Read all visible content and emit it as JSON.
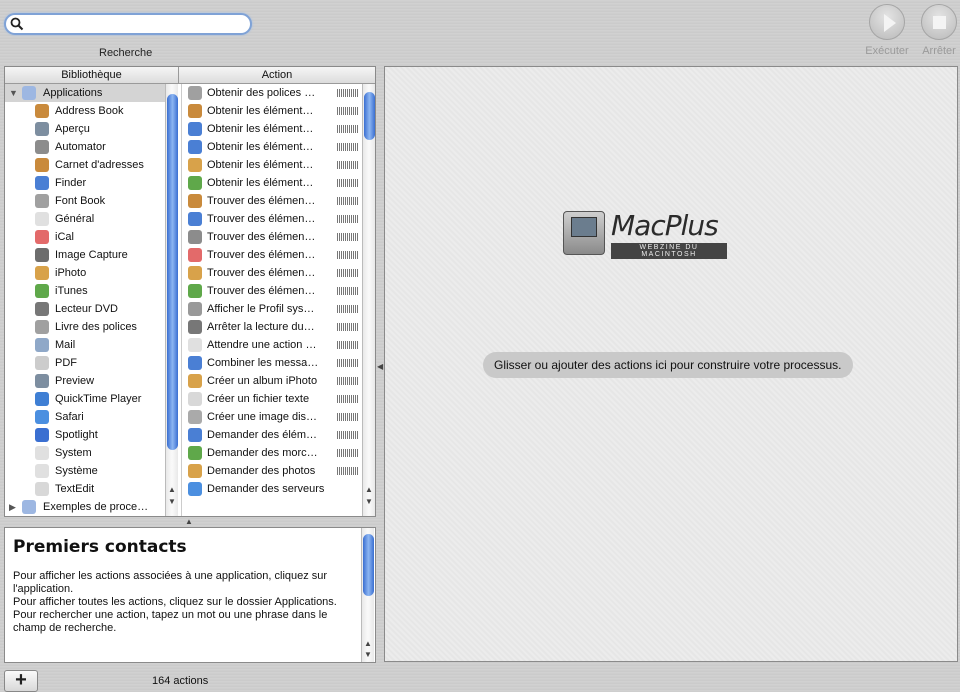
{
  "toolbar": {
    "search_value": "",
    "search_label": "Recherche",
    "run_label": "Exécuter",
    "stop_label": "Arrêter"
  },
  "library": {
    "header": "Bibliothèque",
    "items": [
      {
        "label": "Applications",
        "icon": "applications-folder-icon",
        "color": "#9db7e2",
        "top": true,
        "selected": true,
        "tri": "▼"
      },
      {
        "label": "Address Book",
        "icon": "address-book-icon",
        "color": "#c98a3c"
      },
      {
        "label": "Aperçu",
        "icon": "preview-icon",
        "color": "#7d8ea0"
      },
      {
        "label": "Automator",
        "icon": "automator-icon",
        "color": "#8c8c8c"
      },
      {
        "label": "Carnet d'adresses",
        "icon": "address-book-icon",
        "color": "#c98a3c"
      },
      {
        "label": "Finder",
        "icon": "finder-icon",
        "color": "#4a7fd4"
      },
      {
        "label": "Font Book",
        "icon": "font-book-icon",
        "color": "#a0a0a0"
      },
      {
        "label": "Général",
        "icon": "general-x-icon",
        "color": "#e0e0e0"
      },
      {
        "label": "iCal",
        "icon": "ical-icon",
        "color": "#e36a6a"
      },
      {
        "label": "Image Capture",
        "icon": "camera-icon",
        "color": "#6d6d6d"
      },
      {
        "label": "iPhoto",
        "icon": "iphoto-icon",
        "color": "#d8a24a"
      },
      {
        "label": "iTunes",
        "icon": "itunes-icon",
        "color": "#5fa84a"
      },
      {
        "label": "Lecteur DVD",
        "icon": "dvd-icon",
        "color": "#777777"
      },
      {
        "label": "Livre des polices",
        "icon": "font-book-icon",
        "color": "#a0a0a0"
      },
      {
        "label": "Mail",
        "icon": "mail-icon",
        "color": "#8fa8c8"
      },
      {
        "label": "PDF",
        "icon": "pdf-icon",
        "color": "#cccccc"
      },
      {
        "label": "Preview",
        "icon": "preview-icon",
        "color": "#7d8ea0"
      },
      {
        "label": "QuickTime Player",
        "icon": "quicktime-icon",
        "color": "#3f7fd4"
      },
      {
        "label": "Safari",
        "icon": "safari-icon",
        "color": "#4b8fe0"
      },
      {
        "label": "Spotlight",
        "icon": "spotlight-icon",
        "color": "#3a6fd1"
      },
      {
        "label": "System",
        "icon": "system-x-icon",
        "color": "#e0e0e0"
      },
      {
        "label": "Système",
        "icon": "system-x-icon",
        "color": "#e0e0e0"
      },
      {
        "label": "TextEdit",
        "icon": "textedit-icon",
        "color": "#d8d8d8"
      },
      {
        "label": "Exemples de proce…",
        "icon": "folder-icon",
        "color": "#9db7e2",
        "top": true,
        "tri": "▶"
      }
    ]
  },
  "actions": {
    "header": "Action",
    "items": [
      {
        "label": "Obtenir des polices …",
        "icon": "font-book-icon",
        "color": "#a0a0a0",
        "rate": true
      },
      {
        "label": "Obtenir les élément…",
        "icon": "address-book-icon",
        "color": "#c98a3c",
        "rate": true
      },
      {
        "label": "Obtenir les élément…",
        "icon": "finder-icon",
        "color": "#4a7fd4",
        "rate": true
      },
      {
        "label": "Obtenir les élément…",
        "icon": "finder-icon",
        "color": "#4a7fd4",
        "rate": true
      },
      {
        "label": "Obtenir les élément…",
        "icon": "iphoto-icon",
        "color": "#d8a24a",
        "rate": true
      },
      {
        "label": "Obtenir les élément…",
        "icon": "itunes-icon",
        "color": "#5fa84a",
        "rate": true
      },
      {
        "label": "Trouver des élémen…",
        "icon": "address-book-icon",
        "color": "#c98a3c",
        "rate": true
      },
      {
        "label": "Trouver des élémen…",
        "icon": "finder-icon",
        "color": "#4a7fd4",
        "rate": true
      },
      {
        "label": "Trouver des élémen…",
        "icon": "automator-icon",
        "color": "#8c8c8c",
        "rate": true
      },
      {
        "label": "Trouver des élémen…",
        "icon": "ical-icon",
        "color": "#e36a6a",
        "rate": true
      },
      {
        "label": "Trouver des élémen…",
        "icon": "iphoto-icon",
        "color": "#d8a24a",
        "rate": true
      },
      {
        "label": "Trouver des élémen…",
        "icon": "itunes-icon",
        "color": "#5fa84a",
        "rate": true
      },
      {
        "label": "Afficher le Profil sys…",
        "icon": "system-profiler-icon",
        "color": "#999999",
        "rate": true
      },
      {
        "label": "Arrêter la lecture du…",
        "icon": "dvd-icon",
        "color": "#777777",
        "rate": true
      },
      {
        "label": "Attendre une action …",
        "icon": "general-x-icon",
        "color": "#e0e0e0",
        "rate": true
      },
      {
        "label": "Combiner les messa…",
        "icon": "finder-icon",
        "color": "#4a7fd4",
        "rate": true
      },
      {
        "label": "Créer un album iPhoto",
        "icon": "iphoto-icon",
        "color": "#d8a24a",
        "rate": true
      },
      {
        "label": "Créer un fichier texte",
        "icon": "textedit-icon",
        "color": "#d8d8d8",
        "rate": true
      },
      {
        "label": "Créer une image dis…",
        "icon": "disk-image-icon",
        "color": "#aaaaaa",
        "rate": true
      },
      {
        "label": "Demander des élém…",
        "icon": "finder-icon",
        "color": "#4a7fd4",
        "rate": true
      },
      {
        "label": "Demander des morc…",
        "icon": "itunes-icon",
        "color": "#5fa84a",
        "rate": true
      },
      {
        "label": "Demander des photos",
        "icon": "iphoto-icon",
        "color": "#d8a24a",
        "rate": true
      },
      {
        "label": "Demander des serveurs",
        "icon": "network-icon",
        "color": "#4b8fe0",
        "rate": false
      }
    ]
  },
  "description": {
    "title": "Premiers contacts",
    "lines": [
      "Pour afficher les actions associées à une application, cliquez sur l'application.",
      "Pour afficher toutes les actions, cliquez sur le dossier Applications.",
      "Pour rechercher une action, tapez un mot ou une phrase dans le champ de recherche."
    ]
  },
  "footer": {
    "add_label": "+",
    "count_label": "164 actions"
  },
  "workflow": {
    "logo_brand": "MacPlus",
    "logo_sub": "WEBZINE DU MACINTOSH",
    "hint": "Glisser ou ajouter des actions ici pour construire votre processus."
  }
}
